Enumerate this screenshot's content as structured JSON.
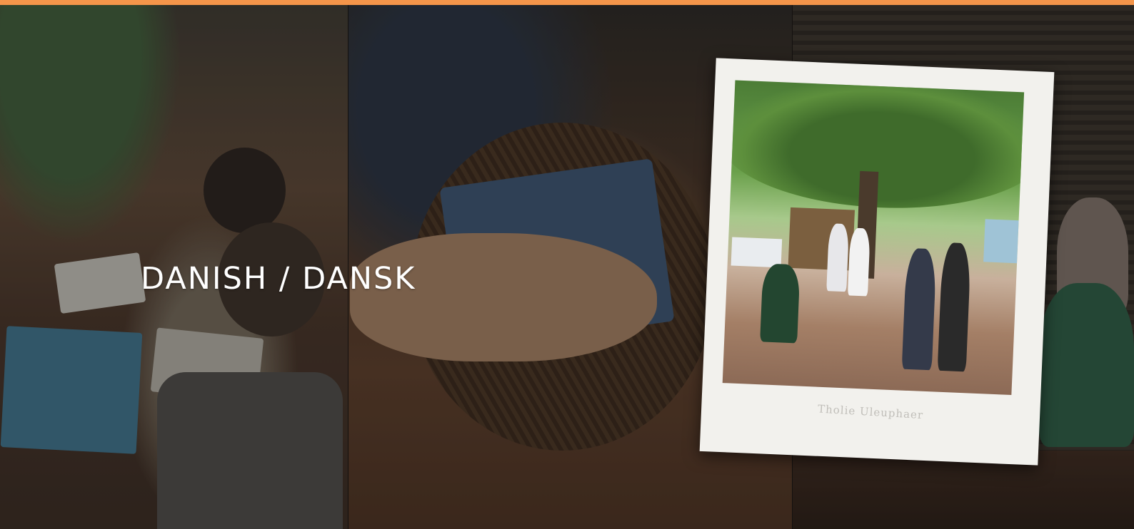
{
  "accent_color": "#f4954a",
  "hero": {
    "heading": "DANISH / DANSK",
    "polaroid_caption": "Tholie Uleuphaer"
  }
}
